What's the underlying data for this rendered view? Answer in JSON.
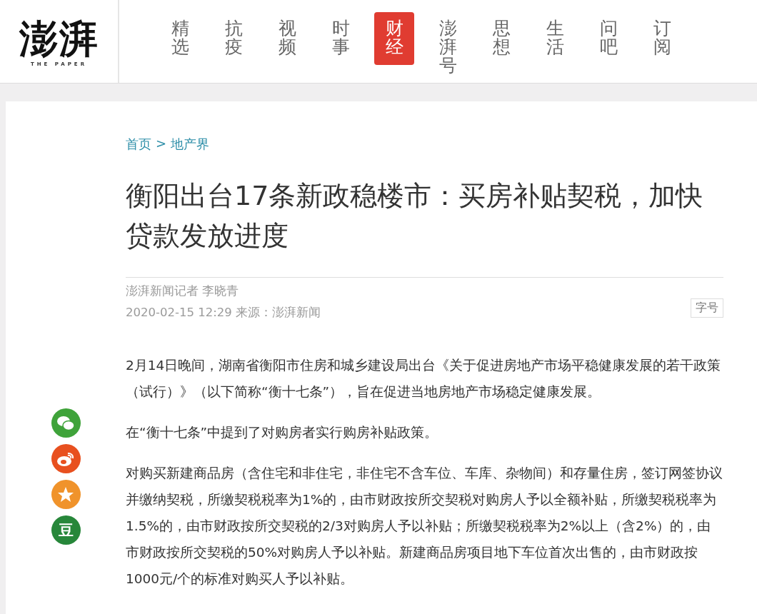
{
  "logo": {
    "title": "澎湃",
    "subtitle": "THE PAPER"
  },
  "nav": [
    {
      "label": "精选",
      "selected": false
    },
    {
      "label": "抗疫",
      "selected": false
    },
    {
      "label": "视频",
      "selected": false
    },
    {
      "label": "时事",
      "selected": false
    },
    {
      "label": "财经",
      "selected": true
    },
    {
      "label": "澎湃号",
      "selected": false
    },
    {
      "label": "思想",
      "selected": false
    },
    {
      "label": "生活",
      "selected": false
    },
    {
      "label": "问吧",
      "selected": false
    },
    {
      "label": "订阅",
      "selected": false
    }
  ],
  "share": [
    {
      "kind": "wechat",
      "color": "#3fa33a"
    },
    {
      "kind": "weibo",
      "color": "#e8501f"
    },
    {
      "kind": "star",
      "color": "#f0932b"
    },
    {
      "kind": "douban",
      "color": "#27873a",
      "label": "豆"
    }
  ],
  "breadcrumb": [
    {
      "label": "首页"
    },
    {
      "label": "地产界"
    }
  ],
  "breadcrumb_separator": ">",
  "title": "衡阳出台17条新政稳楼市：买房补贴契税，加快贷款发放进度",
  "author": "澎湃新闻记者 李晓青",
  "meta": "2020-02-15 12:29 来源：澎湃新闻",
  "font_size_button": "字号",
  "paragraphs": [
    "2月14日晚间，湖南省衡阳市住房和城乡建设局出台《关于促进房地产市场平稳健康发展的若干政策（试行）》（以下简称“衡十七条”），旨在促进当地房地产市场稳定健康发展。",
    "在“衡十七条”中提到了对购房者实行购房补贴政策。",
    "对购买新建商品房（含住宅和非住宅，非住宅不含车位、车库、杂物间）和存量住房，签订网签协议并缴纳契税，所缴契税税率为1%的，由市财政按所交契税对购房人予以全额补贴，所缴契税税率为1.5%的，由市财政按所交契税的2/3对购房人予以补贴；所缴契税税率为2%以上（含2%）的，由市财政按所交契税的50%对购房人予以补贴。新建商品房项目地下车位首次出售的，由市财政按1000元/个的标准对购买人予以补贴。"
  ]
}
